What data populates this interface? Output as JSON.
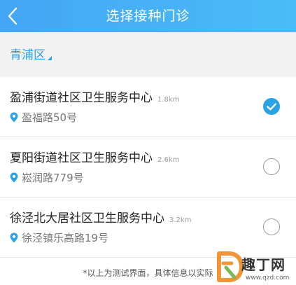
{
  "header": {
    "title": "选择接种门诊",
    "back_icon": "chevron-left-icon"
  },
  "district": {
    "label": "青浦区"
  },
  "clinics": [
    {
      "name": "盈浦街道社区卫生服务中心",
      "distance": "1.8km",
      "address": "盈福路50号",
      "selected": true
    },
    {
      "name": "夏阳街道社区卫生服务中心",
      "distance": "2.6km",
      "address": "崧润路779号",
      "selected": false
    },
    {
      "name": "徐泾北大居社区卫生服务中心",
      "distance": "3.2km",
      "address": "徐泾镇乐高路19号",
      "selected": false
    }
  ],
  "footer": {
    "note": "*以上为测试界面，具体信息以实际"
  },
  "watermark": {
    "brand": "趣丁网",
    "url": "www.qzd.com"
  },
  "colors": {
    "header_start": "#43a6f6",
    "header_end": "#4bbcf7",
    "accent": "#2aa2e6",
    "district_bar_bg": "#f2f2f2",
    "watermark_orange": "#f08a24"
  }
}
